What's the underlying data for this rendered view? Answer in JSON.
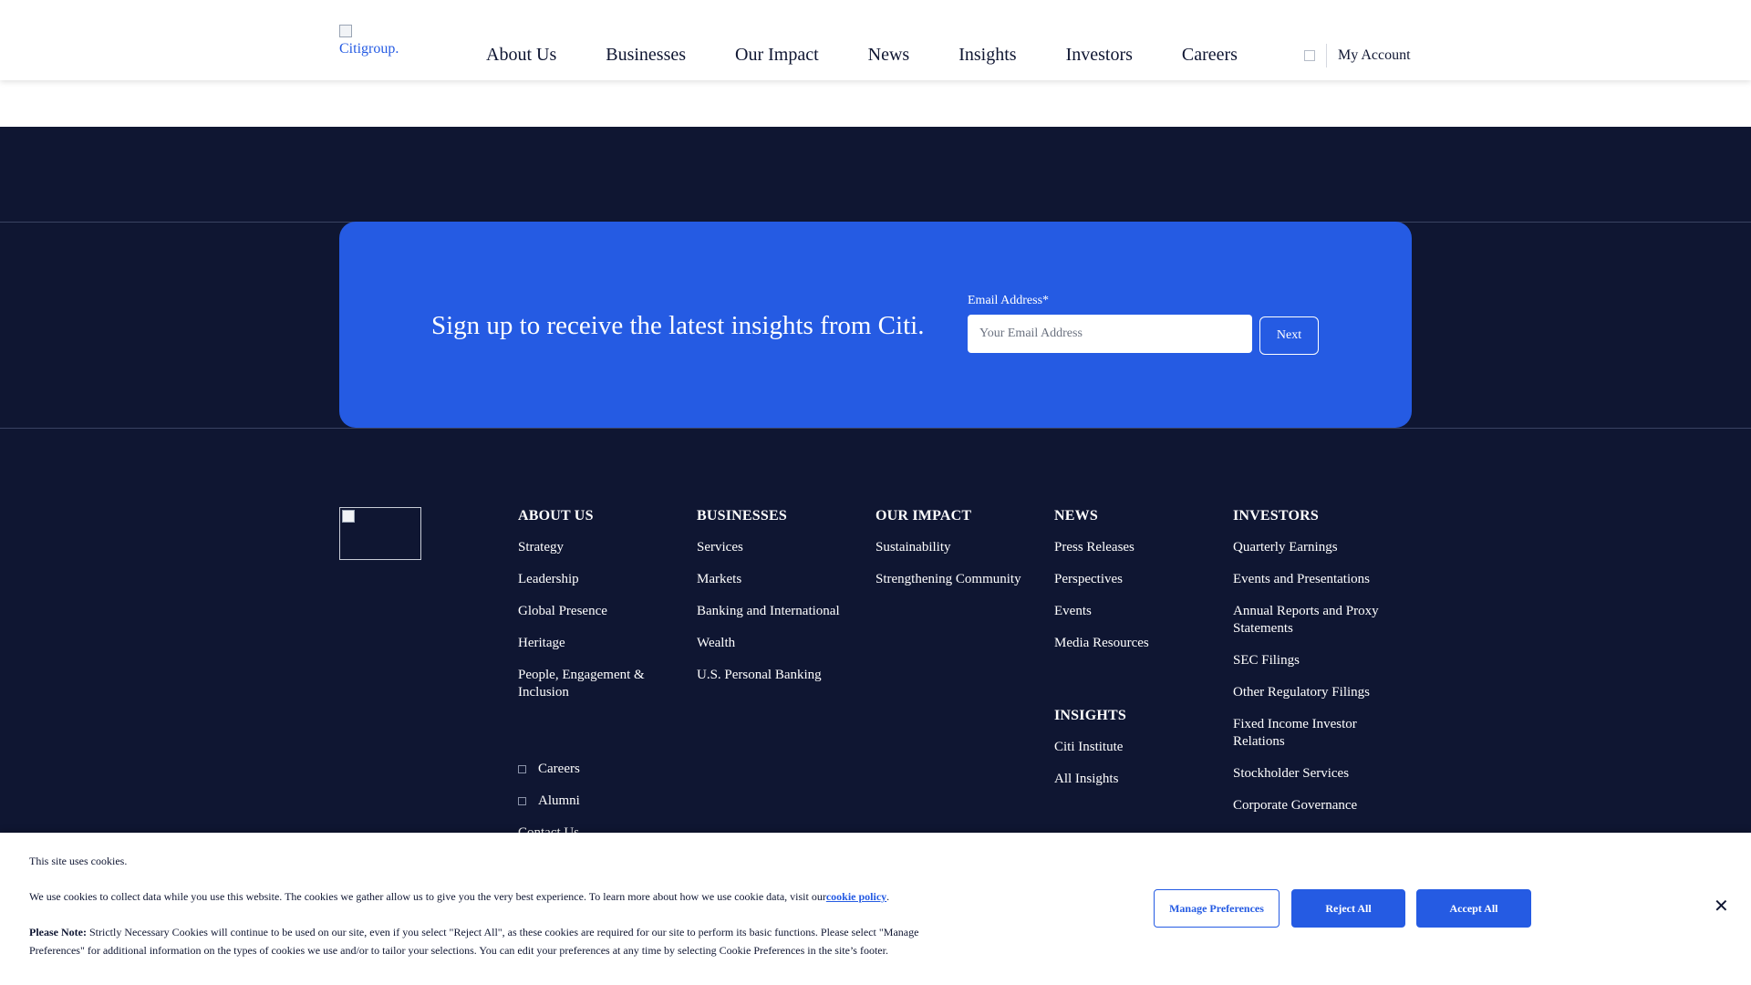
{
  "header": {
    "logo_alt": "Citigroup.",
    "nav": [
      "About Us",
      "Businesses",
      "Our Impact",
      "News",
      "Insights",
      "Investors",
      "Careers"
    ],
    "account_label": "My Account"
  },
  "signup": {
    "headline": "Sign up to receive the latest insights from Citi.",
    "email_label": "Email Address*",
    "email_placeholder": "Your Email Address",
    "email_value": "",
    "next_label": "Next"
  },
  "footer": {
    "columns": [
      {
        "heading": "ABOUT US",
        "links": [
          "Strategy",
          "Leadership",
          "Global Presence",
          "Heritage",
          "People, Engagement & Inclusion"
        ]
      },
      {
        "heading": "BUSINESSES",
        "links": [
          "Services",
          "Markets",
          "Banking and International",
          "Wealth",
          "U.S. Personal Banking"
        ]
      },
      {
        "heading": "OUR IMPACT",
        "links": [
          "Sustainability",
          "Strengthening Community"
        ]
      },
      {
        "heading": "NEWS",
        "links": [
          "Press Releases",
          "Perspectives",
          "Events",
          "Media Resources"
        ]
      },
      {
        "heading": "INVESTORS",
        "links": [
          "Quarterly Earnings",
          "Events and Presentations",
          "Annual Reports and Proxy Statements",
          "SEC Filings",
          "Other Regulatory Filings",
          "Fixed Income Investor Relations",
          "Stockholder Services",
          "Corporate Governance"
        ]
      }
    ],
    "insights": {
      "heading": "INSIGHTS",
      "links": [
        "Citi Institute",
        "All Insights"
      ]
    },
    "external_links": [
      "Careers",
      "Alumni"
    ],
    "contact_label": "Contact Us"
  },
  "cookie": {
    "title": "This site uses cookies.",
    "body_text": "We use cookies to collect data while you use this website. The cookies we gather allow us to give you the very best experience. To learn more about how we use cookie data, visit our",
    "policy_link": "cookie policy",
    "note_label": "Please Note:",
    "note_text": " Strictly Necessary Cookies will continue to be used on our site, even if you select \"Reject All\", as these cookies are required for our site to perform its basic functions. Please select \"Manage Preferences\" for additional information on the types of cookies we use and/or to tailor your selections. You can edit your preferences at any time by selecting Cookie Preferences in the site’s footer.",
    "manage_label": "Manage Preferences",
    "reject_label": "Reject All",
    "accept_label": "Accept All",
    "close_symbol": "✕"
  },
  "colors": {
    "navy": "#0f1632",
    "accent_blue": "#255be3",
    "white": "#ffffff"
  },
  "icons": [
    "user-icon",
    "external-link-icon",
    "close-icon"
  ]
}
